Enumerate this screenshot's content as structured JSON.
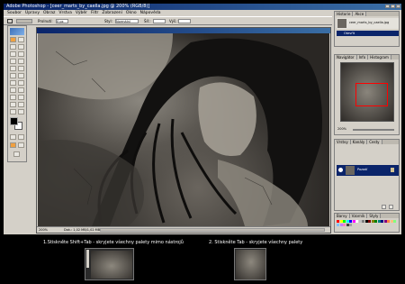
{
  "app": {
    "title": "Adobe Photoshop - [ceer_marts_by_caella.jpg @ 200% (RGB/8)]",
    "menu": [
      "Soubor",
      "Úpravy",
      "Obraz",
      "Vrstva",
      "Výběr",
      "Filtr",
      "Zobrazení",
      "Okno",
      "Nápověda"
    ]
  },
  "options_bar": {
    "feather_label": "Prolnutí:",
    "feather_value": "0 px",
    "style_label": "Styl:",
    "style_value": "Normální",
    "width_label": "Šíř.:",
    "height_label": "Výš.:"
  },
  "status": {
    "zoom": "200%",
    "doc": "Dok.: 1,02 MB/1,02 MB"
  },
  "palettes": {
    "history": {
      "tabs": [
        "Historie",
        "Akce"
      ],
      "items": [
        "ceer_marts_by_caella.jpg",
        "Otevřít"
      ]
    },
    "navigator": {
      "tabs": [
        "Navigátor",
        "Info",
        "Histogram"
      ],
      "zoom": "200%"
    },
    "layers": {
      "tabs": [
        "Vrstvy",
        "Kanály",
        "Cesty"
      ],
      "layer_name": "Pozadí"
    },
    "swatches": {
      "tabs": [
        "Barvy",
        "Vzorník",
        "Styly"
      ]
    }
  },
  "captions": {
    "left": "1.Stiskněte Shift+Tab - skryjete všechny palety mimo nástrojů",
    "right": "2. Stiskněte Tab - skryjete všechny palety"
  },
  "colors": {
    "title_blue": "#0a246a",
    "chrome": "#d4d0c8",
    "foreground": "#000000",
    "background": "#ffffff",
    "swatches": [
      "#ff0000",
      "#ffff00",
      "#00ff00",
      "#00ffff",
      "#0000ff",
      "#ff00ff",
      "#ffffff",
      "#c0c0c0",
      "#808080",
      "#000000",
      "#800000",
      "#808000",
      "#008000",
      "#008080",
      "#000080",
      "#800080",
      "#ff8040",
      "#ffc080",
      "#80ff80",
      "#80c0ff",
      "#c080ff",
      "#ff80c0",
      "#404040",
      "#a0a0a0"
    ]
  },
  "icons": [
    "photoshop-logo-icon",
    "marquee-tool-icon",
    "move-tool-icon",
    "lasso-tool-icon",
    "magic-wand-tool-icon",
    "crop-tool-icon",
    "brush-tool-icon",
    "eraser-tool-icon",
    "gradient-tool-icon",
    "text-tool-icon",
    "pen-tool-icon",
    "hand-tool-icon",
    "zoom-tool-icon",
    "eye-icon",
    "trash-icon",
    "new-layer-icon"
  ]
}
